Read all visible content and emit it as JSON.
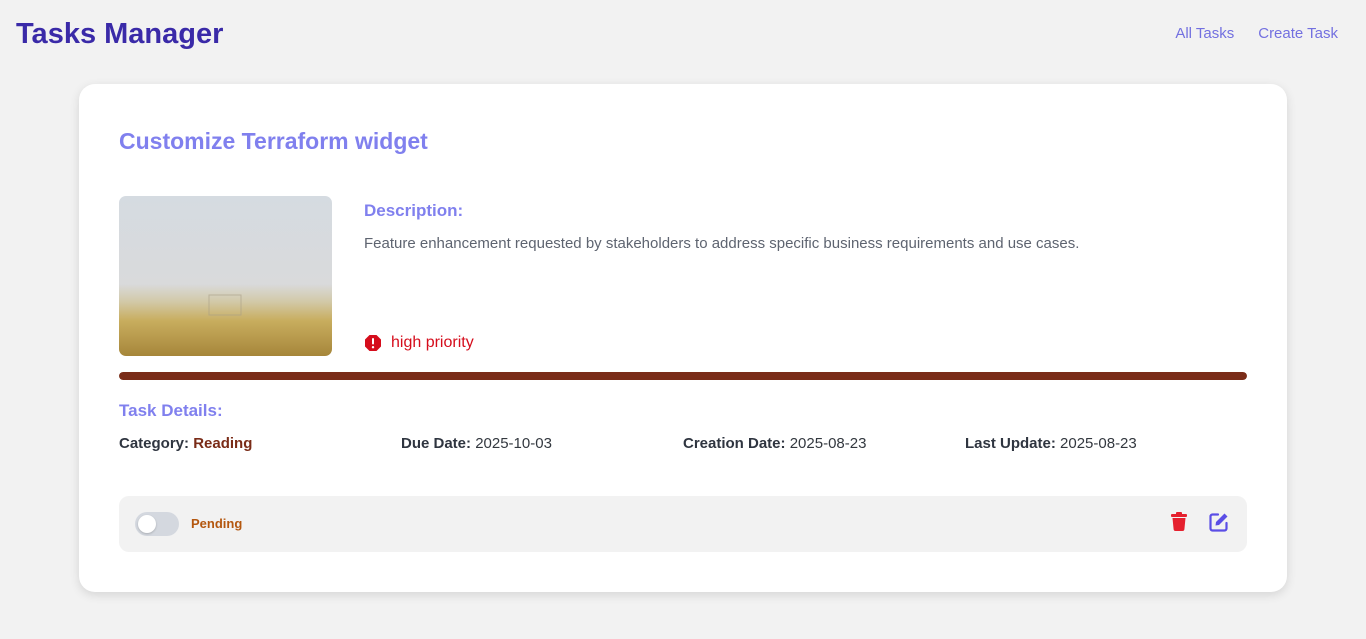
{
  "header": {
    "title": "Tasks Manager",
    "nav": {
      "all_tasks": "All Tasks",
      "create_task": "Create Task"
    }
  },
  "task": {
    "title": "Customize Terraform widget",
    "description_label": "Description:",
    "description": "Feature enhancement requested by stakeholders to address specific business requirements and use cases.",
    "priority": "high priority",
    "progress_fraction": 1.0,
    "details_label": "Task Details:",
    "details": {
      "category_label": "Category:",
      "category": "Reading",
      "due_label": "Due Date:",
      "due": "2025-10-03",
      "created_label": "Creation Date:",
      "created": "2025-08-23",
      "updated_label": "Last Update:",
      "updated": "2025-08-23"
    },
    "status": "Pending"
  },
  "icons": {
    "priority": "alert-octagon-icon",
    "delete": "trash-icon",
    "edit": "edit-icon"
  },
  "colors": {
    "brand": "#3a2aa8",
    "accent": "#8080ee",
    "priority_high": "#d50d1c",
    "progress": "#7a2c18",
    "pending": "#b4570f",
    "delete": "#e5202e",
    "edit": "#5b4ee6"
  }
}
